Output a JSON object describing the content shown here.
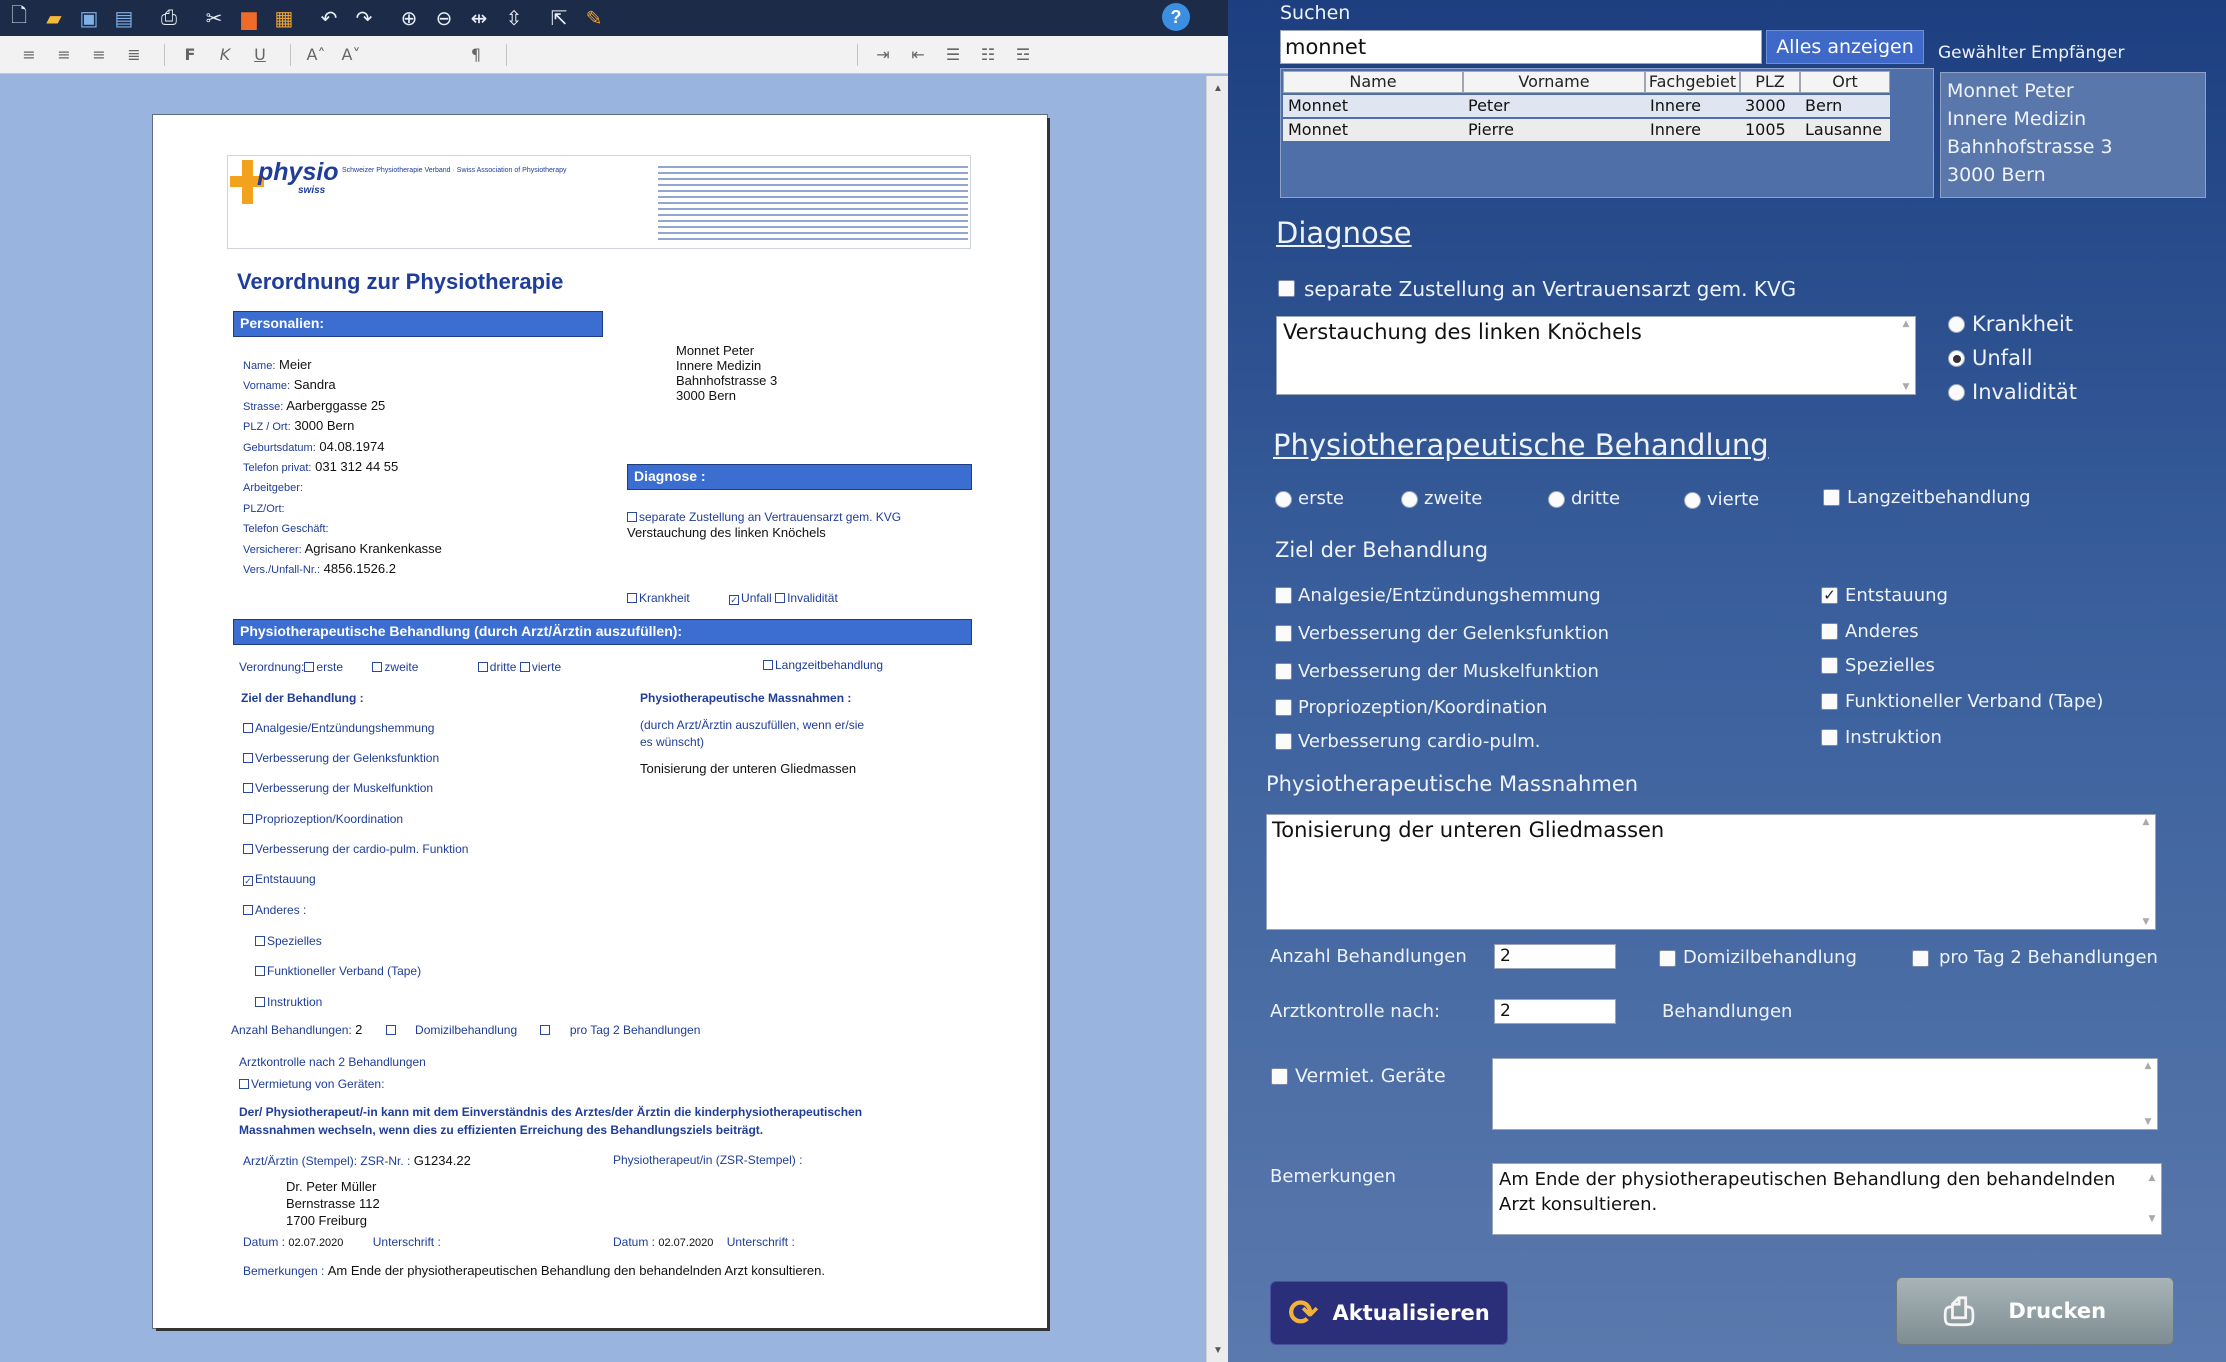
{
  "toolbar": {
    "icons": [
      "new-file",
      "open-folder",
      "save",
      "save-all",
      "print",
      "cut",
      "copy",
      "paste",
      "undo",
      "redo",
      "zoom-in",
      "zoom-out",
      "fit-width",
      "fit-height",
      "export",
      "pen"
    ],
    "format_bold": "F",
    "format_italic": "K",
    "format_underline": "U",
    "font_grow": "A˄",
    "font_shrink": "A˅",
    "pilcrow": "¶"
  },
  "doc": {
    "logo_text": "physio",
    "logo_sub": "swiss",
    "header_text": "Schweizer Physiotherapie Verband · Swiss Association of Physiotherapy",
    "title": "Verordnung zur Physiotherapie",
    "section_personalien": "Personalien:",
    "personal": [
      {
        "label": "Name:",
        "value": "Meier"
      },
      {
        "label": "Vorname:",
        "value": "Sandra"
      },
      {
        "label": "Strasse:",
        "value": "Aarberggasse 25"
      },
      {
        "label": "PLZ / Ort:",
        "value": "3000 Bern"
      },
      {
        "label": "Geburtsdatum:",
        "value": "04.08.1974"
      },
      {
        "label": "Telefon privat:",
        "value": "031 312 44 55"
      },
      {
        "label": "Arbeitgeber:",
        "value": ""
      },
      {
        "label": "PLZ/Ort:",
        "value": ""
      },
      {
        "label": "Telefon Geschäft:",
        "value": ""
      },
      {
        "label": "Versicherer:",
        "value": "Agrisano Krankenkasse"
      },
      {
        "label": "Vers./Unfall-Nr.:",
        "value": "4856.1526.2"
      }
    ],
    "recipient": [
      "Monnet Peter",
      "Innere Medizin",
      "Bahnhofstrasse 3",
      "3000 Bern"
    ],
    "section_diagnose": "Diagnose :",
    "diag_checkbox": "separate Zustellung an Vertrauensarzt gem. KVG",
    "diag_text": "Verstauchung des linken Knöchels",
    "diag_krankheit": "Krankheit",
    "diag_unfall": "Unfall",
    "diag_invaliditaet": "Invalidität",
    "section_behandlung": "Physiotherapeutische Behandlung (durch Arzt/Ärztin auszufüllen):",
    "verordnung_label": "Verordnung:",
    "v_erste": "erste",
    "v_zweite": "zweite",
    "v_dritte": "dritte",
    "v_vierte": "vierte",
    "v_lang": "Langzeitbehandlung",
    "ziel_title": "Ziel der Behandlung :",
    "ziele": [
      {
        "text": "Analgesie/Entzündungshemmung",
        "checked": false,
        "indent": 0
      },
      {
        "text": "Verbesserung der Gelenksfunktion",
        "checked": false,
        "indent": 0
      },
      {
        "text": "Verbesserung der Muskelfunktion",
        "checked": false,
        "indent": 0
      },
      {
        "text": "Propriozeption/Koordination",
        "checked": false,
        "indent": 0
      },
      {
        "text": "Verbesserung der cardio-pulm. Funktion",
        "checked": false,
        "indent": 0
      },
      {
        "text": "Entstauung",
        "checked": true,
        "indent": 0
      },
      {
        "text": "Anderes :",
        "checked": false,
        "indent": 0
      },
      {
        "text": "Spezielles",
        "checked": false,
        "indent": 1
      },
      {
        "text": "Funktioneller Verband (Tape)",
        "checked": false,
        "indent": 1
      },
      {
        "text": "Instruktion",
        "checked": false,
        "indent": 1
      }
    ],
    "massnahmen_title": "Physiotherapeutische Massnahmen :",
    "massnahmen_hint1": "(durch Arzt/Ärztin auszufüllen, wenn er/sie",
    "massnahmen_hint2": "es wünscht)",
    "massnahmen_text": "Tonisierung der unteren Gliedmassen",
    "anzahl_label": "Anzahl Behandlungen:",
    "anzahl_value": "2",
    "domizil": "Domizilbehandlung",
    "protag": "pro Tag 2 Behandlungen",
    "arztkontrolle": "Arztkontrolle nach 2 Behandlungen",
    "vermietung": "Vermietung von Geräten:",
    "disclaimer1": "Der/ Physiotherapeut/-in kann mit dem Einverständnis des Arztes/der Ärztin die kinderphysiotherapeutischen",
    "disclaimer2": "Massnahmen wechseln, wenn dies zu effizienten Erreichung des Behandlungsziels beiträgt.",
    "arzt_stempel_label": "Arzt/Ärztin (Stempel):",
    "zsr_label": "ZSR-Nr. :",
    "zsr_value": "G1234.22",
    "physio_stempel_label": "Physiotherapeut/in (ZSR-Stempel) :",
    "arzt_address": [
      "Dr. Peter Müller",
      "Bernstrasse 112",
      "1700 Freiburg"
    ],
    "datum_label": "Datum :",
    "datum_left": "02.07.2020",
    "unterschrift_label": "Unterschrift :",
    "datum_right": "02.07.2020",
    "bemerkungen_label": "Bemerkungen :",
    "bemerkungen_text": "Am Ende der physiotherapeutischen Behandlung den behandelnden Arzt konsultieren."
  },
  "form": {
    "search_label": "Suchen",
    "search_value": "monnet",
    "show_all_button": "Alles anzeigen",
    "recipient_label": "Gewählter Empfänger",
    "recipient_lines": [
      "Monnet Peter",
      "Innere Medizin",
      "Bahnhofstrasse 3",
      "3000 Bern"
    ],
    "columns": [
      "Name",
      "Vorname",
      "Fachgebiet",
      "PLZ",
      "Ort"
    ],
    "rows": [
      [
        "Monnet",
        "Peter",
        "Innere",
        "3000",
        "Bern"
      ],
      [
        "Monnet",
        "Pierre",
        "Innere",
        "1005",
        "Lausanne"
      ]
    ],
    "diagnose_title": "Diagnose",
    "separate_label": "separate Zustellung an Vertrauensarzt gem. KVG",
    "diagnose_text": "Verstauchung des linken Knöchels",
    "radio_krankheit": "Krankheit",
    "radio_unfall": "Unfall",
    "radio_invaliditaet": "Invalidität",
    "behandlung_title": "Physiotherapeutische Behandlung",
    "r_erste": "erste",
    "r_zweite": "zweite",
    "r_dritte": "dritte",
    "r_vierte": "vierte",
    "langzeit": "Langzeitbehandlung",
    "ziel_title": "Ziel der Behandlung",
    "ziel_left": [
      "Analgesie/Entzündungshemmung",
      "Verbesserung der Gelenksfunktion",
      "Verbesserung der Muskelfunktion",
      "Propriozeption/Koordination",
      "Verbesserung cardio-pulm."
    ],
    "ziel_right": [
      "Entstauung",
      "Anderes",
      "Spezielles",
      "Funktioneller Verband (Tape)",
      "Instruktion"
    ],
    "massnahmen_title": "Physiotherapeutische Massnahmen",
    "massnahmen_text": "Tonisierung der unteren Gliedmassen",
    "anzahl_label": "Anzahl Behandlungen",
    "anzahl_value": "2",
    "domizil": "Domizilbehandlung",
    "protag": "pro Tag 2 Behandlungen",
    "arztkontrolle_label": "Arztkontrolle nach:",
    "arztkontrolle_value": "2",
    "behandlungen_suffix": "Behandlungen",
    "vermiet_label": "Vermiet. Geräte",
    "vermiet_value": "",
    "bemerkungen_label": "Bemerkungen",
    "bemerkungen_text": "Am Ende der physiotherapeutischen Behandlung den behandelnden Arzt konsultieren.",
    "aktualisieren_button": "Aktualisieren",
    "drucken_button": "Drucken"
  },
  "colors": {
    "toolbar_bg": "#1c2b47",
    "doc_section_blue": "#3b6ed0",
    "form_bg_top": "#1d3f80",
    "show_all_bg": "#3f69c9",
    "aktualisieren_bg": "#2b2f7a",
    "drucken_bg": "#8d9ba0"
  }
}
